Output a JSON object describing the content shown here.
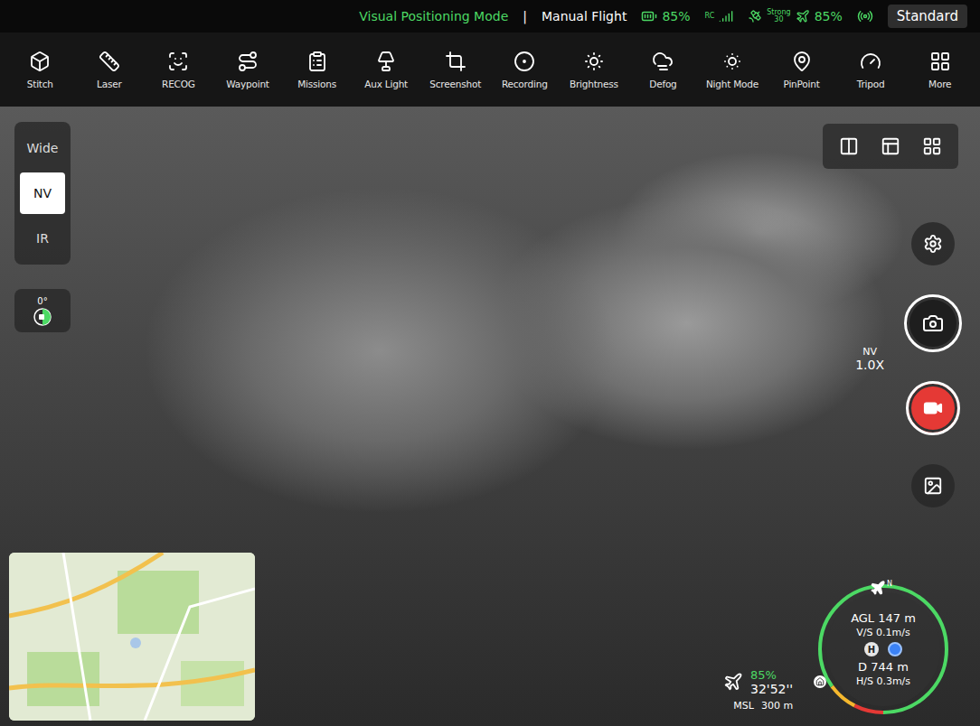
{
  "status_bar": {
    "flight_status": "Visual Positioning Mode",
    "separator": "|",
    "flight_mode": "Manual Flight",
    "rc_battery": "85%",
    "rc_label": "RC",
    "signal_label": "Strong",
    "signal_value": "30",
    "aircraft_battery": "85%",
    "mode_button": "Standard"
  },
  "toolbar": [
    {
      "label": "Stitch"
    },
    {
      "label": "Laser"
    },
    {
      "label": "RECOG"
    },
    {
      "label": "Waypoint"
    },
    {
      "label": "Missions"
    },
    {
      "label": "Aux Light"
    },
    {
      "label": "Screenshot"
    },
    {
      "label": "Recording"
    },
    {
      "label": "Brightness"
    },
    {
      "label": "Defog"
    },
    {
      "label": "Night Mode"
    },
    {
      "label": "PinPoint"
    },
    {
      "label": "Tripod"
    },
    {
      "label": "More"
    }
  ],
  "lens_selector": [
    {
      "label": "Wide",
      "selected": false
    },
    {
      "label": "NV",
      "selected": true
    },
    {
      "label": "IR",
      "selected": false
    }
  ],
  "gimbal": {
    "angle": "0°"
  },
  "zoom": {
    "lens": "NV",
    "factor": "1.0X"
  },
  "flight_data": {
    "battery": "85%",
    "time": "32'52''",
    "msl_label": "MSL",
    "msl_value": "300 m"
  },
  "compass": {
    "north": "N",
    "agl_label": "AGL",
    "agl_value": "147 m",
    "vs_label": "V/S",
    "vs_value": "0.1m/s",
    "home_marker": "H",
    "distance_label": "D",
    "distance_value": "744 m",
    "hs_label": "H/S",
    "hs_value": "0.3m/s",
    "level": 0.85
  }
}
